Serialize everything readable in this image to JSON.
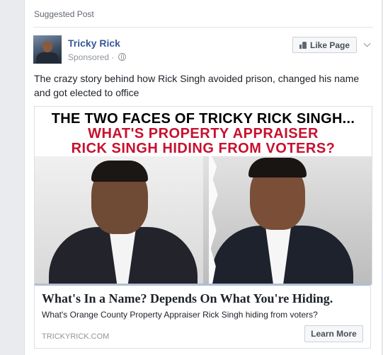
{
  "post": {
    "suggested_label": "Suggested Post",
    "page_name": "Tricky Rick",
    "sponsored_label": "Sponsored",
    "separator": "·",
    "like_button_label": "Like Page",
    "text": "The crazy story behind how Rick Singh avoided prison, changed his name and got elected to office"
  },
  "ad_image": {
    "line1": "THE TWO FACES OF TRICKY RICK SINGH...",
    "line2": "WHAT'S PROPERTY APPRAISER",
    "line3": "RICK SINGH HIDING FROM VOTERS?"
  },
  "ad_caption": {
    "headline": "What's In a Name? Depends On What You're Hiding.",
    "description": "What's Orange County Property Appraiser Rick Singh hiding from voters?",
    "domain": "TRICKYRICK.COM",
    "cta_label": "Learn More"
  },
  "colors": {
    "link_blue": "#365899",
    "headline_red": "#c8102e",
    "muted": "#90949c",
    "background": "#e9ebee"
  },
  "icons": {
    "like": "thumbs-up-icon",
    "menu": "chevron-down-icon",
    "audience": "globe-icon"
  }
}
